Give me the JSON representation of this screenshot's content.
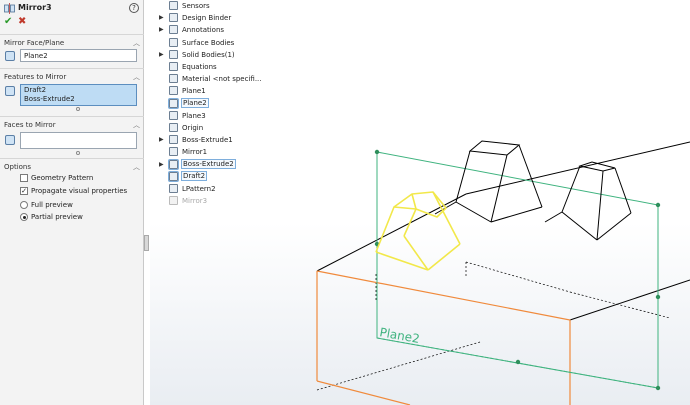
{
  "property_manager": {
    "title": "Mirror3",
    "help": "?",
    "ok": "✔",
    "cancel": "✖",
    "mirror_face": {
      "header": "Mirror Face/Plane",
      "value": "Plane2"
    },
    "features": {
      "header": "Features to Mirror",
      "items": [
        "Draft2",
        "Boss-Extrude2"
      ]
    },
    "faces": {
      "header": "Faces to Mirror",
      "value": ""
    },
    "options": {
      "header": "Options",
      "geometry_pattern": {
        "label": "Geometry Pattern",
        "checked": false
      },
      "propagate": {
        "label": "Propagate visual properties",
        "checked": true
      },
      "full_preview": {
        "label": "Full preview",
        "selected": false
      },
      "partial_preview": {
        "label": "Partial preview",
        "selected": true
      }
    }
  },
  "tree": {
    "items": [
      {
        "label": "Sensors",
        "expandable": false
      },
      {
        "label": "Design Binder",
        "expandable": true
      },
      {
        "label": "Annotations",
        "expandable": true
      },
      {
        "label": "Surface Bodies",
        "expandable": false
      },
      {
        "label": "Solid Bodies(1)",
        "expandable": true
      },
      {
        "label": "Equations",
        "expandable": false
      },
      {
        "label": "Material <not specifi...",
        "expandable": false
      },
      {
        "label": "Plane1",
        "expandable": false
      },
      {
        "label": "Plane2",
        "expandable": false,
        "highlighted": true
      },
      {
        "label": "Plane3",
        "expandable": false
      },
      {
        "label": "Origin",
        "expandable": false
      },
      {
        "label": "Boss-Extrude1",
        "expandable": true
      },
      {
        "label": "Mirror1",
        "expandable": false
      },
      {
        "label": "Boss-Extrude2",
        "expandable": true,
        "highlighted": true
      },
      {
        "label": "Draft2",
        "expandable": false,
        "highlighted": true
      },
      {
        "label": "LPattern2",
        "expandable": false
      },
      {
        "label": "Mirror3",
        "expandable": false,
        "dimmed": true
      }
    ]
  },
  "viewport": {
    "plane_label": "Plane2",
    "colors": {
      "plane": "#3fb37f",
      "highlight_edges": "#f08a3c",
      "preview": "#f2e84a",
      "edges": "#000000"
    }
  }
}
